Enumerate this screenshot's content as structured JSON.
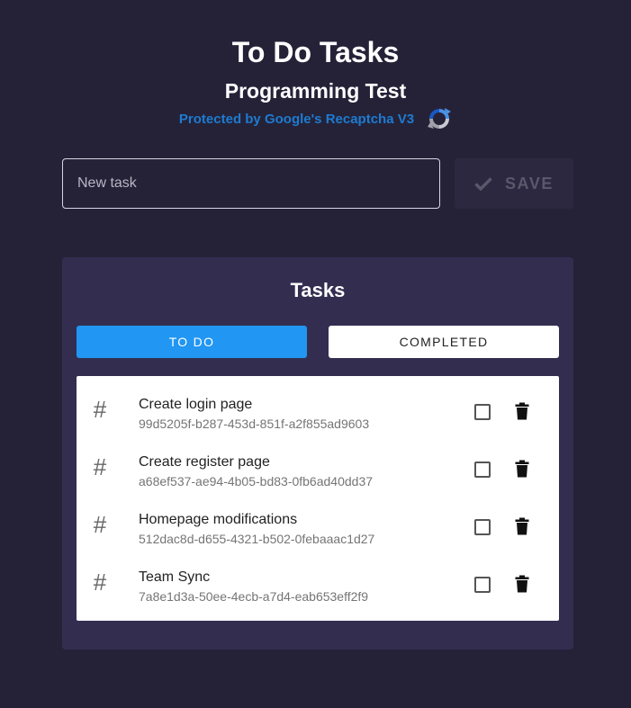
{
  "header": {
    "title": "To Do Tasks",
    "subtitle": "Programming Test",
    "recaptcha_text": "Protected by Google's Recaptcha V3",
    "recaptcha_icon": "recaptcha-icon"
  },
  "new_task": {
    "placeholder": "New task",
    "value": ""
  },
  "save_button": {
    "label": "SAVE",
    "icon": "check-icon",
    "disabled": true
  },
  "tasks_card": {
    "title": "Tasks",
    "tabs": [
      {
        "label": "TO DO",
        "active": true
      },
      {
        "label": "COMPLETED",
        "active": false
      }
    ],
    "items": [
      {
        "name": "Create login page",
        "id": "99d5205f-b287-453d-851f-a2f855ad9603",
        "done": false
      },
      {
        "name": "Create register page",
        "id": "a68ef537-ae94-4b05-bd83-0fb6ad40dd37",
        "done": false
      },
      {
        "name": "Homepage modifications",
        "id": "512dac8d-d655-4321-b502-0febaaac1d27",
        "done": false
      },
      {
        "name": "Team Sync",
        "id": "7a8e1d3a-50ee-4ecb-a7d4-eab653eff2f9",
        "done": false
      }
    ]
  },
  "colors": {
    "background": "#252238",
    "card": "#332e50",
    "accent": "#2196f3",
    "recaptcha_link": "#1e7bd0"
  }
}
